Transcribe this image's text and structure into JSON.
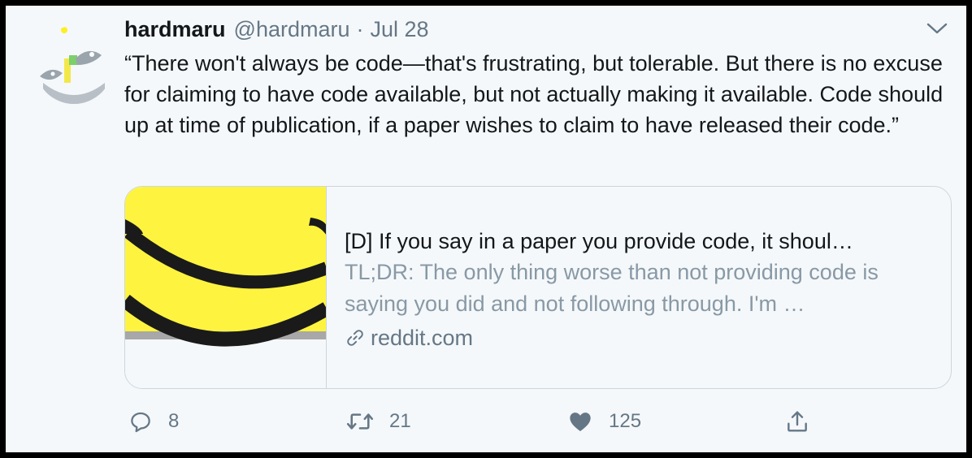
{
  "tweet": {
    "author_name": "hardmaru",
    "author_handle": "@hardmaru",
    "separator": "·",
    "date": "Jul 28",
    "text": "“There won't always be code—that's frustrating, but tolerable. But there is no excuse for claiming to have code available, but not actually making it available. Code should up at time of publication, if a paper wishes to claim to have released their code.”"
  },
  "card": {
    "title": "[D] If you say in a paper you provide code, it shoul…",
    "description": "TL;DR: The only thing worse than not providing code is saying you did and not following through. I'm …",
    "domain": "reddit.com",
    "domain_icon": "link-icon",
    "image_colors": {
      "background": "#fef43f",
      "stroke": "#1a1a1a"
    }
  },
  "actions": {
    "reply_count": "8",
    "retweet_count": "21",
    "like_count": "125"
  },
  "colors": {
    "text": "#14171a",
    "secondary": "#657786",
    "muted": "#8899a6",
    "border": "#ccd6dd",
    "background": "#f5f8fa"
  }
}
